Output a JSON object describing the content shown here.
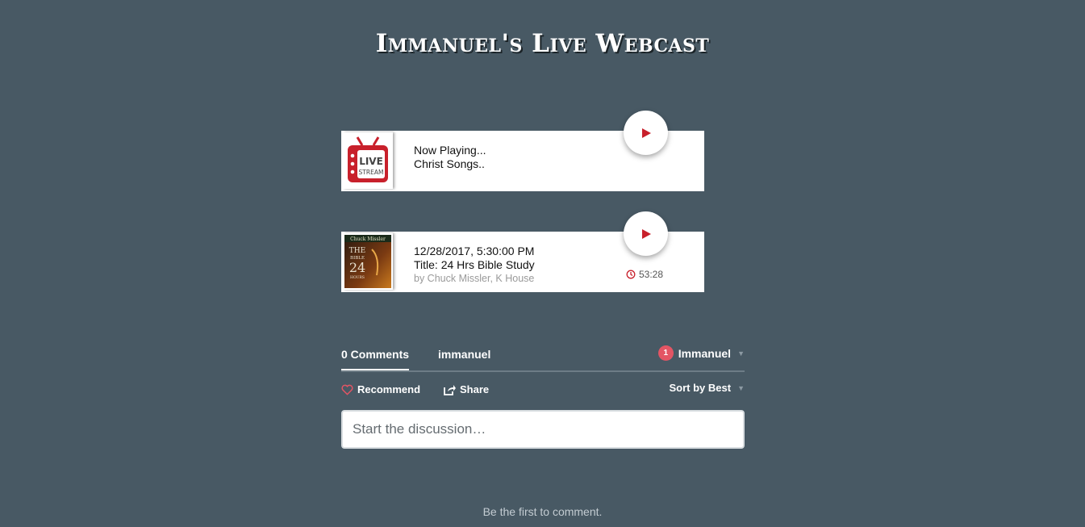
{
  "page": {
    "title": "Immanuel's Live Webcast"
  },
  "cards": [
    {
      "thumb_label": "live-stream-thumbnail",
      "lines": [
        "Now Playing...",
        "Christ Songs.."
      ]
    },
    {
      "thumb_label": "bible-study-thumbnail",
      "date": "12/28/2017, 5:30:00 PM",
      "title": "Title: 24 Hrs Bible Study",
      "author": "by Chuck Missler, K House",
      "duration": "53:28"
    }
  ],
  "comments": {
    "tab_count": "0 Comments",
    "tab_community": "immanuel",
    "user_name": "Immanuel",
    "notification_count": "1",
    "recommend_label": "Recommend",
    "share_label": "Share",
    "sort_label": "Sort by Best",
    "input_placeholder": "Start the discussion…",
    "empty_message": "Be the first to comment."
  },
  "colors": {
    "background": "#485964",
    "accent": "#c8202b",
    "badge": "#e35564"
  }
}
